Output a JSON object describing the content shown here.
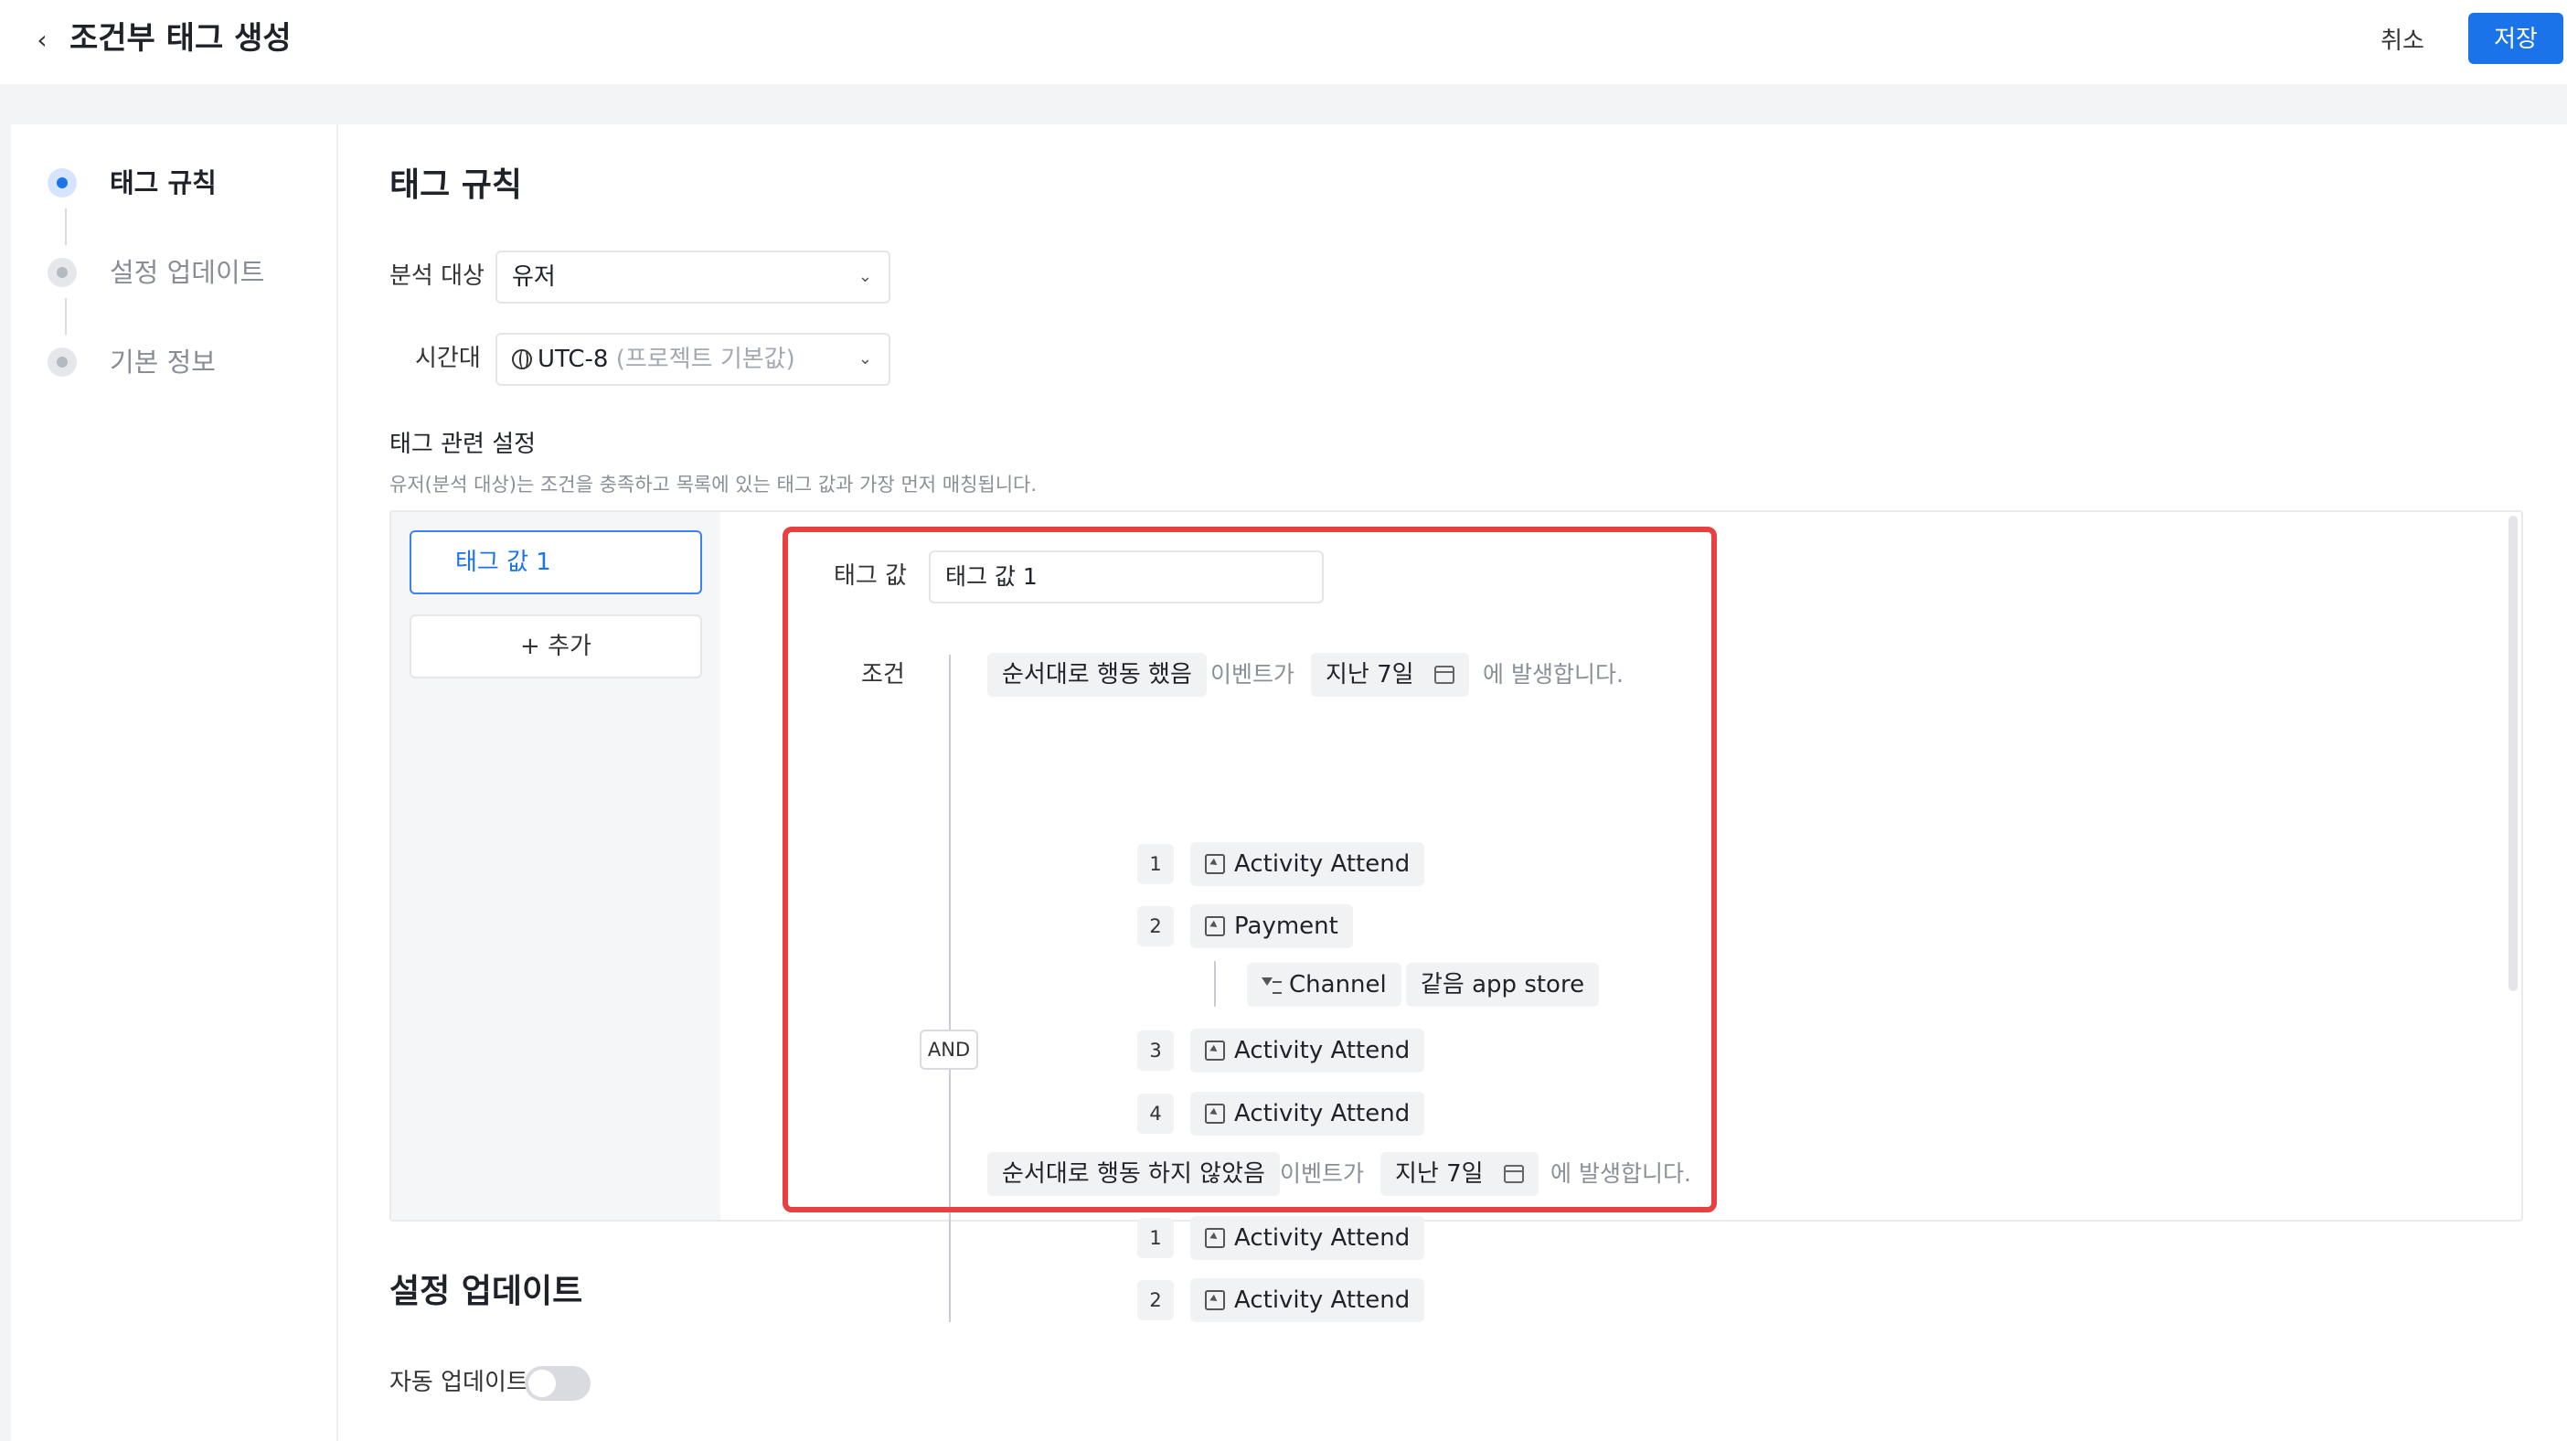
{
  "header": {
    "title": "조건부 태그 생성",
    "cancel_label": "취소",
    "save_label": "저장"
  },
  "steps": [
    {
      "label": "태그 규칙",
      "active": true
    },
    {
      "label": "설정 업데이트",
      "active": false
    },
    {
      "label": "기본 정보",
      "active": false
    }
  ],
  "tag_rule": {
    "heading": "태그 규칙",
    "analysis_target": {
      "label": "분석 대상",
      "value": "유저"
    },
    "timezone": {
      "label": "시간대",
      "value": "UTC-8",
      "note": "(프로젝트 기본값)"
    },
    "settings_title": "태그 관련 설정",
    "settings_hint": "유저(분석 대상)는 조건을 충족하고 목록에 있는 태그 값과 가장 먼저 매칭됩니다.",
    "tag_values": [
      "태그 값 1"
    ],
    "add_label": "+ 추가",
    "editor": {
      "tag_value_label": "태그 값",
      "tag_value_input": "태그 값 1",
      "condition_label": "조건",
      "and_label": "AND",
      "groups": [
        {
          "mode": "순서대로 행동 했음",
          "event_word": "이벤트가",
          "period": "지난 7일",
          "suffix": "에 발생합니다.",
          "events": [
            {
              "index": "1",
              "name": "Activity Attend"
            },
            {
              "index": "2",
              "name": "Payment",
              "filter": {
                "property": "Channel",
                "operator": "같음",
                "value": "app store"
              }
            },
            {
              "index": "3",
              "name": "Activity Attend"
            },
            {
              "index": "4",
              "name": "Activity Attend"
            }
          ]
        },
        {
          "mode": "순서대로 행동 하지 않았음",
          "event_word": "이벤트가",
          "period": "지난 7일",
          "suffix": "에 발생합니다.",
          "events": [
            {
              "index": "1",
              "name": "Activity Attend"
            },
            {
              "index": "2",
              "name": "Activity Attend"
            }
          ]
        }
      ]
    }
  },
  "setting_update": {
    "heading": "설정 업데이트",
    "auto_update_label": "자동 업데이트",
    "auto_update_on": false
  },
  "colors": {
    "accent": "#1a73e8",
    "highlight": "#e84040"
  }
}
